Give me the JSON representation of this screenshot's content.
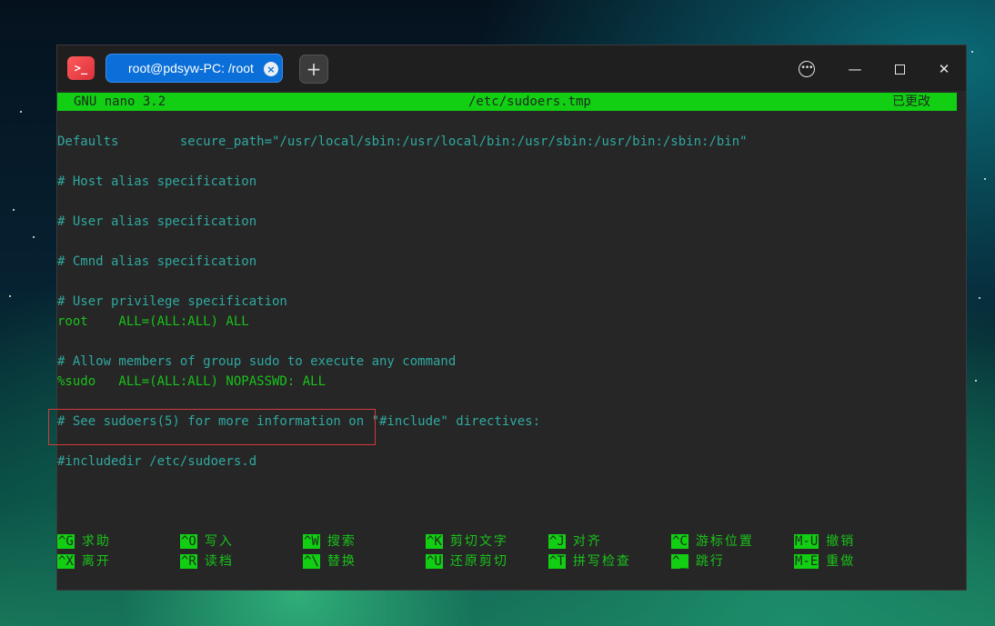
{
  "window": {
    "tab_title": "root@pdsyw-PC: /root",
    "app_icon_text": ">_",
    "new_tab_symbol": "+",
    "tab_close_symbol": "×",
    "menu_symbol": "•••",
    "minimize_symbol": "—",
    "close_symbol": "✕"
  },
  "nano": {
    "version": "GNU nano 3.2",
    "filename": "/etc/sudoers.tmp",
    "modified": "已更改"
  },
  "file_lines": [
    {
      "text": "Defaults        secure_path=\"/usr/local/sbin:/usr/local/bin:/usr/sbin:/usr/bin:/sbin:/bin\"",
      "color": "teal"
    },
    {
      "text": "",
      "color": "teal"
    },
    {
      "text": "# Host alias specification",
      "color": "teal"
    },
    {
      "text": "",
      "color": "teal"
    },
    {
      "text": "# User alias specification",
      "color": "teal"
    },
    {
      "text": "",
      "color": "teal"
    },
    {
      "text": "# Cmnd alias specification",
      "color": "teal"
    },
    {
      "text": "",
      "color": "teal"
    },
    {
      "text": "# User privilege specification",
      "color": "teal"
    },
    {
      "text": "root    ALL=(ALL:ALL) ALL",
      "color": "green"
    },
    {
      "text": "",
      "color": "teal"
    },
    {
      "text": "# Allow members of group sudo to execute any command",
      "color": "teal"
    },
    {
      "text": "%sudo   ALL=(ALL:ALL) NOPASSWD: ALL",
      "color": "green"
    },
    {
      "text": "",
      "color": "teal"
    },
    {
      "text": "# See sudoers(5) for more information on \"#include\" directives:",
      "color": "teal"
    },
    {
      "text": "",
      "color": "teal"
    },
    {
      "text": "#includedir /etc/sudoers.d",
      "color": "teal"
    }
  ],
  "shortcuts": [
    {
      "key": "^G",
      "label": "求助"
    },
    {
      "key": "^X",
      "label": "离开"
    },
    {
      "key": "^O",
      "label": "写入"
    },
    {
      "key": "^R",
      "label": "读档"
    },
    {
      "key": "^W",
      "label": "搜索"
    },
    {
      "key": "^\\",
      "label": "替换"
    },
    {
      "key": "^K",
      "label": "剪切文字"
    },
    {
      "key": "^U",
      "label": "还原剪切"
    },
    {
      "key": "^J",
      "label": "对齐"
    },
    {
      "key": "^T",
      "label": "拼写检查"
    },
    {
      "key": "^C",
      "label": "游标位置"
    },
    {
      "key": "^_",
      "label": "跳行"
    },
    {
      "key": "M-U",
      "label": "撤销"
    },
    {
      "key": "M-E",
      "label": "重做"
    }
  ],
  "colors": {
    "status_bar": "#12cf14",
    "text_green": "#19c21a",
    "text_teal": "#2fa9a0",
    "highlight_box": "#d33a3a",
    "tab_active": "#0a6fd8"
  }
}
